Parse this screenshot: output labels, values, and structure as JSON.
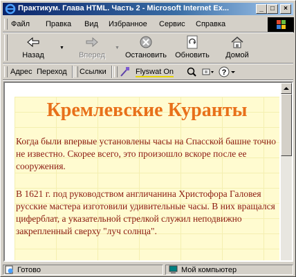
{
  "window": {
    "title": "Практикум. Глава HTML. Часть 2 - Microsoft Internet Ex..."
  },
  "menu": {
    "items": [
      "Файл",
      "Правка",
      "Вид",
      "Избранное",
      "Сервис",
      "Справка"
    ]
  },
  "toolbar": {
    "back_label": "Назад",
    "forward_label": "Вперед",
    "stop_label": "Остановить",
    "refresh_label": "Обновить",
    "home_label": "Домой"
  },
  "addressbar": {
    "address_label": "Адрес",
    "go_label": "Переход",
    "links_label": "Ссылки",
    "flyswat_label": "Flyswat On"
  },
  "page": {
    "heading": "Кремлевские Куранты",
    "paragraphs": [
      "Когда были впервые установлены часы на Спасской башне точно не известно. Скорее всего, это произошло вскоре после ее сооружения.",
      "В 1621 г. под руководством англичанина Христофора Галовея русские мастера изготовили удивительные часы. В них вращался циферблат, а указательной стрелкой служил неподвижно закрепленный сверху \"луч солнца\"."
    ]
  },
  "status": {
    "text": "Готово",
    "zone": "Мой компьютер"
  },
  "colors": {
    "heading": "#e8701a",
    "body_text": "#8b1a10",
    "page_background": "#fffbd0",
    "titlebar": "#0a246a"
  }
}
